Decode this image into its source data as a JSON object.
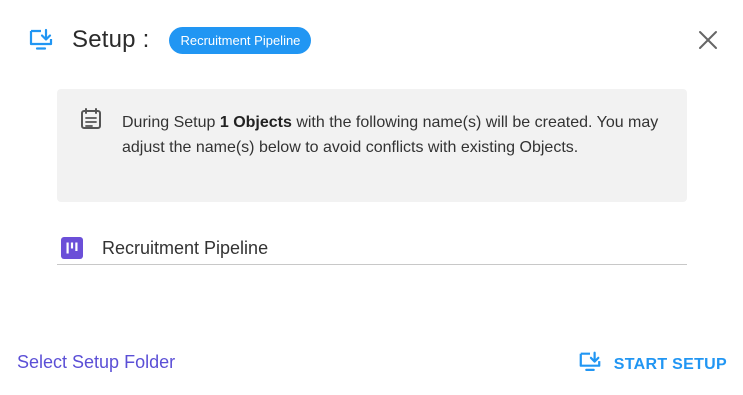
{
  "header": {
    "title": "Setup :",
    "badge": "Recruitment Pipeline",
    "icon": "setup-download-icon",
    "close_icon": "close-icon"
  },
  "info": {
    "icon": "list-icon",
    "prefix": "During Setup ",
    "count_text": "1 Objects",
    "suffix": " with the following name(s) will be created. You may adjust the name(s) below to avoid conflicts with existing Objects."
  },
  "object": {
    "icon": "board-icon",
    "name": "Recruitment Pipeline"
  },
  "footer": {
    "folder_link": "Select Setup Folder",
    "start_label": "START SETUP"
  },
  "colors": {
    "accent": "#2196f3",
    "link": "#5b4fd6",
    "object_icon": "#6b4fd8",
    "info_bg": "#f2f2f2"
  }
}
